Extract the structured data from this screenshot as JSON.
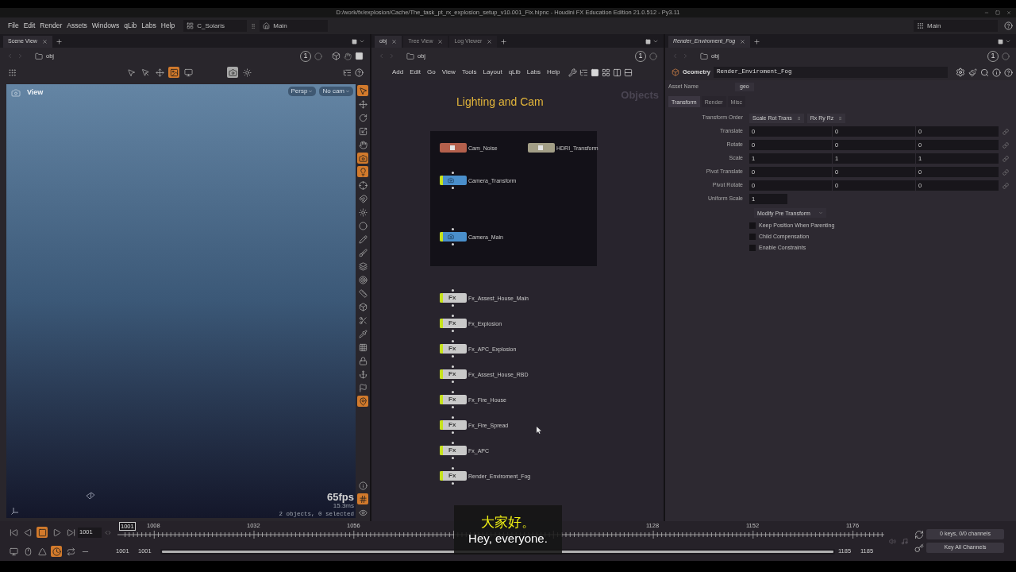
{
  "title_bar": {
    "title": "D:/work/fx/explosion/Cache/The_task_pt_rx_explosion_setup_v10.001_Fix.hipnc - Houdini FX Education Edition 21.0.512 - Py3.11"
  },
  "menu_bar": {
    "menus": [
      "File",
      "Edit",
      "Render",
      "Assets",
      "Windows",
      "qLib",
      "Labs",
      "Help"
    ],
    "desktop": "C_Solaris",
    "stage": "Main",
    "context": "Main"
  },
  "scene_pane": {
    "tabs": [
      {
        "label": "Scene View",
        "selected": true
      }
    ],
    "path": "obj",
    "link_group": "1",
    "tools": [
      {
        "active": false
      },
      {
        "active": false
      },
      {
        "active": false
      },
      {
        "active": false
      },
      {
        "active": true
      },
      {
        "active": false
      },
      {
        "active": true
      },
      {
        "active": false
      }
    ],
    "viewport": {
      "label": "View",
      "camera": "Persp",
      "camera_source": "No cam",
      "fps": "65fps",
      "frame_time": "15.3ms",
      "status": "2 objects, 0 selected"
    },
    "side_tools": [
      {
        "active": true
      },
      {
        "active": false
      },
      {
        "active": false
      },
      {
        "active": false
      },
      {
        "active": false
      },
      {
        "active": true
      },
      {
        "active": true
      },
      {
        "active": false
      },
      {
        "active": false
      },
      {
        "active": false
      },
      {
        "active": false
      },
      {
        "active": false
      },
      {
        "active": false
      },
      {
        "active": false
      },
      {
        "active": false
      },
      {
        "active": false
      },
      {
        "active": false
      },
      {
        "active": false
      },
      {
        "active": false
      },
      {
        "active": false
      },
      {
        "active": false
      },
      {
        "active": false
      },
      {
        "active": false
      },
      {
        "active": true
      }
    ],
    "display_tools": [
      {
        "active": false
      },
      {
        "active": true
      },
      {
        "active": false
      }
    ]
  },
  "network_pane": {
    "tabs": [
      {
        "label": "obj",
        "selected": true
      },
      {
        "label": "Tree View",
        "selected": false
      },
      {
        "label": "Log Viewer",
        "selected": false
      }
    ],
    "path": "obj",
    "link_group": "1",
    "menus": [
      "Add",
      "Edit",
      "Go",
      "View",
      "Tools",
      "Layout",
      "qLib",
      "Labs",
      "Help"
    ],
    "context_label": "Objects",
    "sticky_title": "Lighting and Cam",
    "network_box": {
      "nodes": [
        {
          "name": "Cam_Noise",
          "kind": "null",
          "color": "#b4604c",
          "display_flag": false
        },
        {
          "name": "HDRI_Transform",
          "kind": "null",
          "color": "#a29e86",
          "display_flag": false
        },
        {
          "name": "Camera_Transform",
          "kind": "camera",
          "color": "#4a8fcb",
          "display_flag": true
        },
        {
          "name": "Camera_Main",
          "kind": "camera",
          "color": "#4a8fcb",
          "display_flag": true
        }
      ]
    },
    "nodes": [
      {
        "name": "Fx_Assest_House_Main",
        "kind": "subnet",
        "icon_text": "Fx",
        "color": "#c9c9c9",
        "display_flag": true
      },
      {
        "name": "Fx_Explosion",
        "kind": "subnet",
        "icon_text": "Fx",
        "color": "#c9c9c9",
        "display_flag": true
      },
      {
        "name": "Fx_APC_Explosion",
        "kind": "subnet",
        "icon_text": "Fx",
        "color": "#c9c9c9",
        "display_flag": true
      },
      {
        "name": "Fx_Assest_House_RBD",
        "kind": "subnet",
        "icon_text": "Fx",
        "color": "#c9c9c9",
        "display_flag": true
      },
      {
        "name": "Fx_Fire_House",
        "kind": "subnet",
        "icon_text": "Fx",
        "color": "#c9c9c9",
        "display_flag": true
      },
      {
        "name": "Fx_Fire_Spread",
        "kind": "subnet",
        "icon_text": "Fx",
        "color": "#c9c9c9",
        "display_flag": true
      },
      {
        "name": "Fx_APC",
        "kind": "subnet",
        "icon_text": "Fx",
        "color": "#c9c9c9",
        "display_flag": true
      },
      {
        "name": "Render_Enviroment_Fog",
        "kind": "subnet",
        "icon_text": "Fx",
        "color": "#c9c9c9",
        "display_flag": true
      }
    ]
  },
  "parameter_pane": {
    "tabs": [
      {
        "label": "Render_Enviroment_Fog",
        "selected": true
      }
    ],
    "path": "obj",
    "link_group": "1",
    "node_type": "Geometry",
    "node_name": "Render_Enviroment_Fog",
    "asset_name": {
      "label": "Asset Name",
      "value": "geo"
    },
    "folders": [
      {
        "label": "Transform",
        "selected": true
      },
      {
        "label": "Render",
        "selected": false
      },
      {
        "label": "Misc",
        "selected": false
      }
    ],
    "transform_order": {
      "label": "Transform Order",
      "values": [
        "Scale Rot Trans",
        "Rx Ry Rz"
      ]
    },
    "vectors": [
      {
        "label": "Translate",
        "values": [
          "0",
          "0",
          "0"
        ]
      },
      {
        "label": "Rotate",
        "values": [
          "0",
          "0",
          "0"
        ]
      },
      {
        "label": "Scale",
        "values": [
          "1",
          "1",
          "1"
        ]
      },
      {
        "label": "Pivot Translate",
        "values": [
          "0",
          "0",
          "0"
        ]
      },
      {
        "label": "Pivot Rotate",
        "values": [
          "0",
          "0",
          "0"
        ]
      }
    ],
    "uniform_scale": {
      "label": "Uniform Scale",
      "value": "1"
    },
    "pre_transform_menu": "Modify Pre Transform",
    "toggles": [
      {
        "label": "Keep Position When Parenting",
        "checked": false
      },
      {
        "label": "Child Compensation",
        "checked": false
      },
      {
        "label": "Enable Constraints",
        "checked": false
      }
    ]
  },
  "timeline": {
    "buttons": [
      {
        "active": false
      },
      {
        "active": false
      },
      {
        "active": true
      },
      {
        "active": false
      },
      {
        "active": false
      }
    ],
    "frame": "1001",
    "playhead": "1001",
    "ruler_labels": [
      "1008",
      "1032",
      "1056",
      "1128",
      "1152",
      "1176"
    ],
    "options": [
      {
        "active": false
      },
      {
        "active": false
      },
      {
        "active": false
      },
      {
        "active": true
      },
      {
        "active": false
      },
      {
        "active": false
      }
    ],
    "range_start": [
      "1001",
      "1001"
    ],
    "range_bar": {
      "level": 1
    },
    "range_end": [
      "1185",
      "1185"
    ],
    "keys_status": "0 keys, 0/0 channels",
    "key_button": "Key All Channels"
  },
  "subtitles": [
    {
      "text": "大家好。",
      "kind": "chinese"
    },
    {
      "text": "Hey, everyone.",
      "kind": "english"
    }
  ]
}
